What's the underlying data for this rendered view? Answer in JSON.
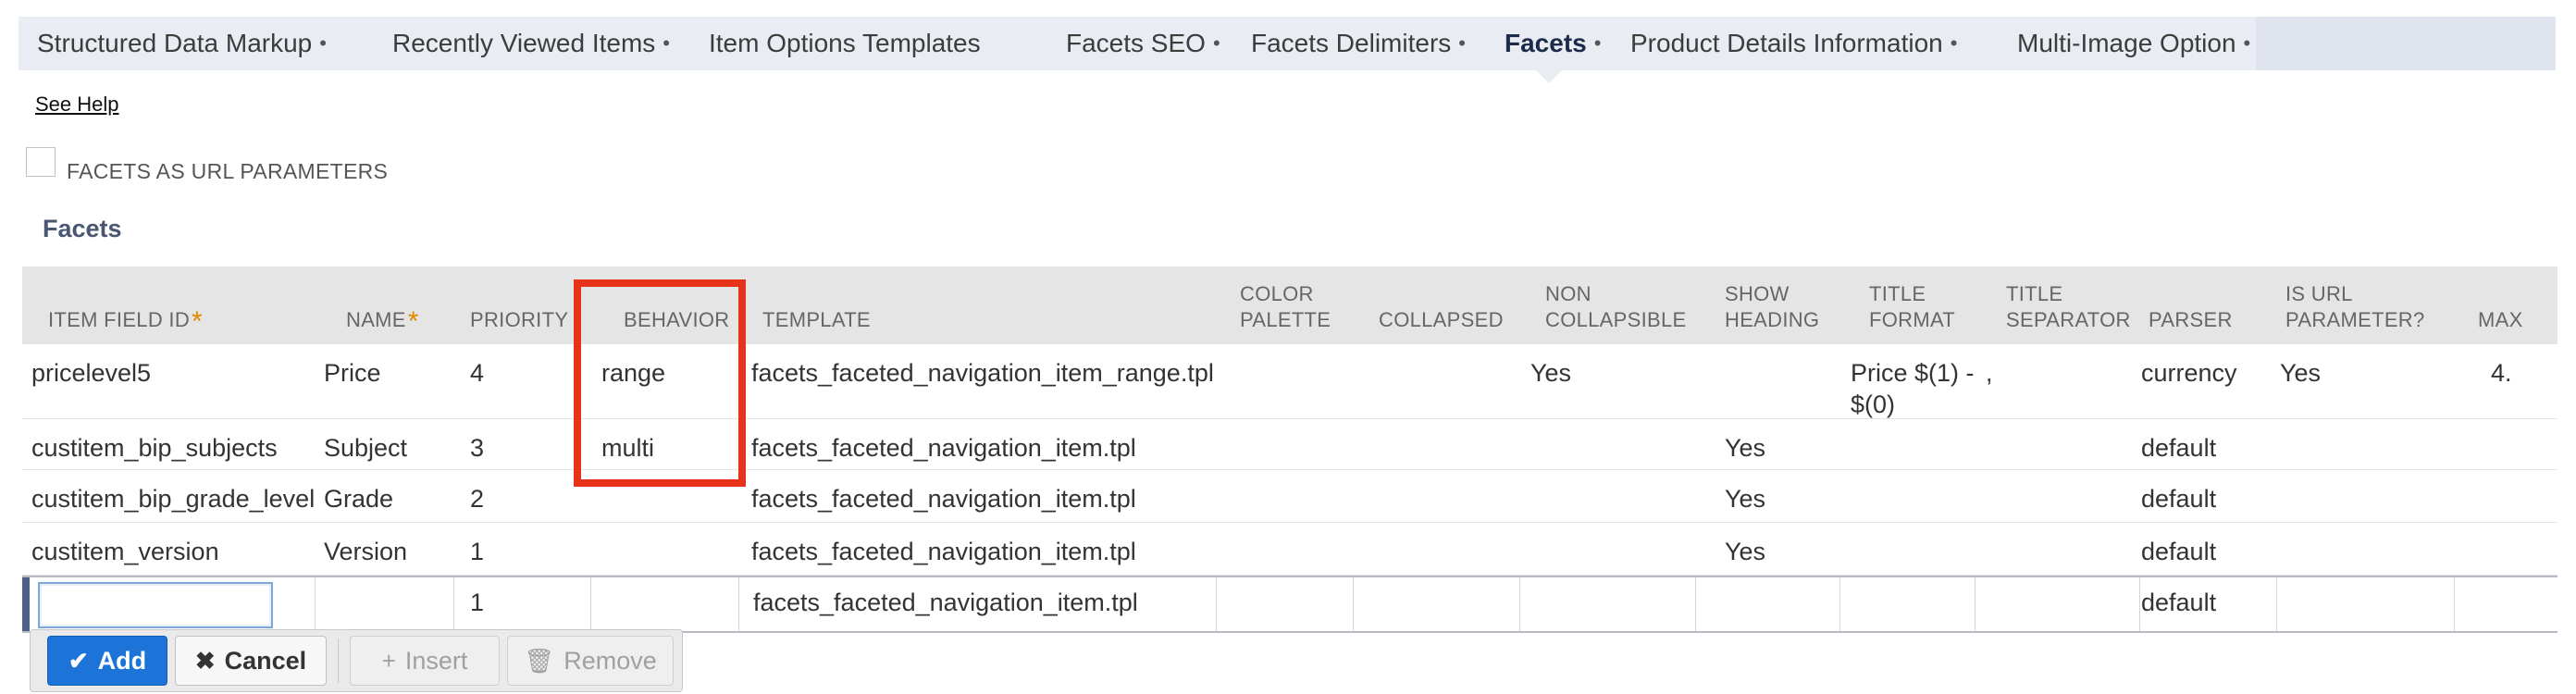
{
  "tabs": [
    {
      "label": "Structured Data Markup",
      "dot": "•"
    },
    {
      "label": "Recently Viewed Items",
      "dot": "•"
    },
    {
      "label": "Item Options Templates",
      "dot": ""
    },
    {
      "label": "Facets SEO",
      "dot": "•"
    },
    {
      "label": "Facets Delimiters",
      "dot": "•"
    },
    {
      "label": "Facets",
      "dot": "•",
      "active": true
    },
    {
      "label": "Product Details Information",
      "dot": "•"
    },
    {
      "label": "Multi-Image Option",
      "dot": "•"
    }
  ],
  "see_help": "See Help",
  "facets_url_param_label": "FACETS AS URL PARAMETERS",
  "section_title": "Facets",
  "columns": [
    {
      "label": "ITEM FIELD ID",
      "required": true
    },
    {
      "label": "NAME",
      "required": true
    },
    {
      "label": "PRIORITY"
    },
    {
      "label": "BEHAVIOR"
    },
    {
      "label": "TEMPLATE"
    },
    {
      "label": "COLOR PALETTE"
    },
    {
      "label": "COLLAPSED"
    },
    {
      "label": "NON COLLAPSIBLE"
    },
    {
      "label": "SHOW HEADING"
    },
    {
      "label": "TITLE FORMAT"
    },
    {
      "label": "TITLE SEPARATOR"
    },
    {
      "label": "PARSER"
    },
    {
      "label": "IS URL PARAMETER?"
    },
    {
      "label": "MAX"
    }
  ],
  "rows": [
    {
      "item_field_id": "pricelevel5",
      "name": "Price",
      "priority": "4",
      "behavior": "range",
      "template": "facets_faceted_navigation_item_range.tpl",
      "color_palette": "",
      "collapsed": "",
      "non_collapsible": "Yes",
      "show_heading": "",
      "title_format": "Price $(1) - $(0)",
      "title_separator": ",",
      "parser": "currency",
      "is_url_parameter": "Yes",
      "max": "4."
    },
    {
      "item_field_id": "custitem_bip_subjects",
      "name": "Subject",
      "priority": "3",
      "behavior": "multi",
      "template": "facets_faceted_navigation_item.tpl",
      "color_palette": "",
      "collapsed": "",
      "non_collapsible": "",
      "show_heading": "Yes",
      "title_format": "",
      "title_separator": "",
      "parser": "default",
      "is_url_parameter": "",
      "max": ""
    },
    {
      "item_field_id": "custitem_bip_grade_level",
      "name": "Grade",
      "priority": "2",
      "behavior": "",
      "template": "facets_faceted_navigation_item.tpl",
      "color_palette": "",
      "collapsed": "",
      "non_collapsible": "",
      "show_heading": "Yes",
      "title_format": "",
      "title_separator": "",
      "parser": "default",
      "is_url_parameter": "",
      "max": ""
    },
    {
      "item_field_id": "custitem_version",
      "name": "Version",
      "priority": "1",
      "behavior": "",
      "template": "facets_faceted_navigation_item.tpl",
      "color_palette": "",
      "collapsed": "",
      "non_collapsible": "",
      "show_heading": "Yes",
      "title_format": "",
      "title_separator": "",
      "parser": "default",
      "is_url_parameter": "",
      "max": ""
    }
  ],
  "edit_row": {
    "item_field_id": "",
    "priority": "1",
    "template": "facets_faceted_navigation_item.tpl",
    "parser": "default"
  },
  "buttons": {
    "add": "Add",
    "cancel": "Cancel",
    "insert": "Insert",
    "remove": "Remove"
  },
  "colors": {
    "highlight": "#e8331c",
    "add_button": "#1c74d9",
    "tab_bar": "#dfe4ee"
  }
}
